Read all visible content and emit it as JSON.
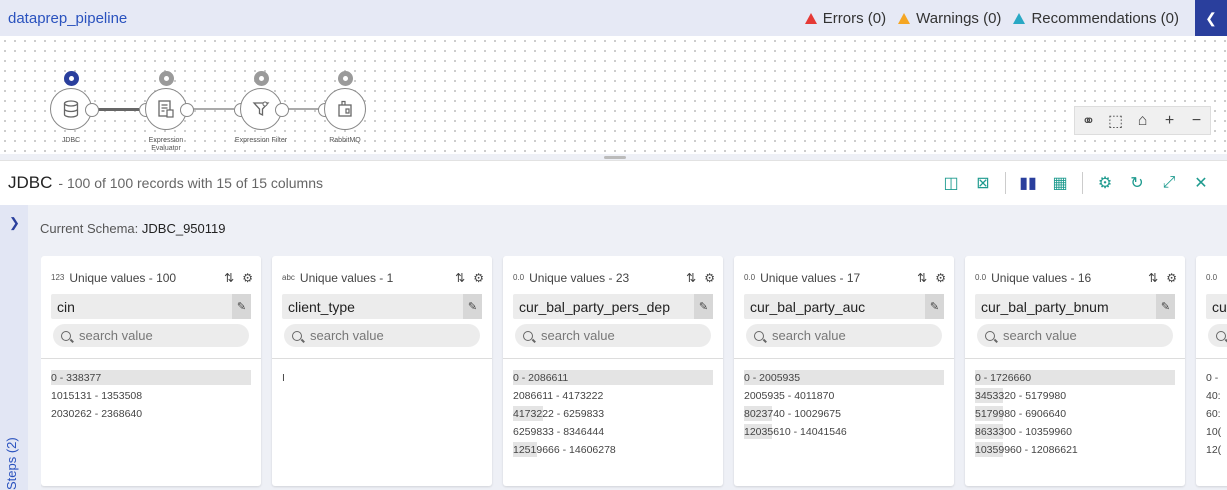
{
  "header": {
    "title": "dataprep_pipeline",
    "errors": "Errors (0)",
    "warnings": "Warnings (0)",
    "recommendations": "Recommendations (0)"
  },
  "pipeline": {
    "nodes": [
      {
        "label": "JDBC",
        "icon": "database-icon",
        "preview_active": true
      },
      {
        "label": "Expression Evaluator",
        "icon": "expression-evaluator-icon",
        "preview_active": false
      },
      {
        "label": "Expression Filter",
        "icon": "filter-icon",
        "preview_active": false
      },
      {
        "label": "RabbitMQ",
        "icon": "rabbitmq-icon",
        "preview_active": false
      }
    ]
  },
  "panel": {
    "title": "JDBC",
    "subtitle": "- 100 of 100 records with 15 of 15 columns"
  },
  "sidebar": {
    "steps_label": "Steps (2)"
  },
  "schema": {
    "label": "Current Schema:",
    "value": "JDBC_950119"
  },
  "columns": [
    {
      "type_icon": "123",
      "unique": "Unique values - 100",
      "name": "cin",
      "search_placeholder": "search value",
      "values": [
        {
          "text": "0 - 338377",
          "fill": 1.0
        },
        {
          "text": "1015131 - 1353508",
          "fill": 0.0
        },
        {
          "text": "2030262 - 2368640",
          "fill": 0.0
        }
      ]
    },
    {
      "type_icon": "abc",
      "unique": "Unique values - 1",
      "name": "client_type",
      "search_placeholder": "search value",
      "values": [
        {
          "text": "I",
          "fill": 0.0
        }
      ]
    },
    {
      "type_icon": "0.0",
      "unique": "Unique values - 23",
      "name": "cur_bal_party_pers_dep",
      "search_placeholder": "search value",
      "values": [
        {
          "text": "0 - 2086611",
          "fill": 1.0
        },
        {
          "text": "2086611 - 4173222",
          "fill": 0.0
        },
        {
          "text": "4173222 - 6259833",
          "fill": 0.15
        },
        {
          "text": "6259833 - 8346444",
          "fill": 0.0
        },
        {
          "text": "12519666 - 14606278",
          "fill": 0.12
        }
      ]
    },
    {
      "type_icon": "0.0",
      "unique": "Unique values - 17",
      "name": "cur_bal_party_auc",
      "search_placeholder": "search value",
      "values": [
        {
          "text": "0 - 2005935",
          "fill": 1.0
        },
        {
          "text": "2005935 - 4011870",
          "fill": 0.0
        },
        {
          "text": "8023740 - 10029675",
          "fill": 0.14
        },
        {
          "text": "12035610 - 14041546",
          "fill": 0.14
        }
      ]
    },
    {
      "type_icon": "0.0",
      "unique": "Unique values - 16",
      "name": "cur_bal_party_bnum",
      "search_placeholder": "search value",
      "values": [
        {
          "text": "0 - 1726660",
          "fill": 1.0
        },
        {
          "text": "3453320 - 5179980",
          "fill": 0.14
        },
        {
          "text": "5179980 - 6906640",
          "fill": 0.14
        },
        {
          "text": "8633300 - 10359960",
          "fill": 0.14
        },
        {
          "text": "10359960 - 12086621",
          "fill": 0.14
        }
      ]
    },
    {
      "type_icon": "0.0",
      "unique": "",
      "name": "cu",
      "search_placeholder": "",
      "values": [
        {
          "text": "0 -",
          "fill": 0.0
        },
        {
          "text": "40:",
          "fill": 0.0
        },
        {
          "text": "60:",
          "fill": 0.0
        },
        {
          "text": "10(",
          "fill": 0.0
        },
        {
          "text": "12(",
          "fill": 0.0
        }
      ]
    }
  ]
}
